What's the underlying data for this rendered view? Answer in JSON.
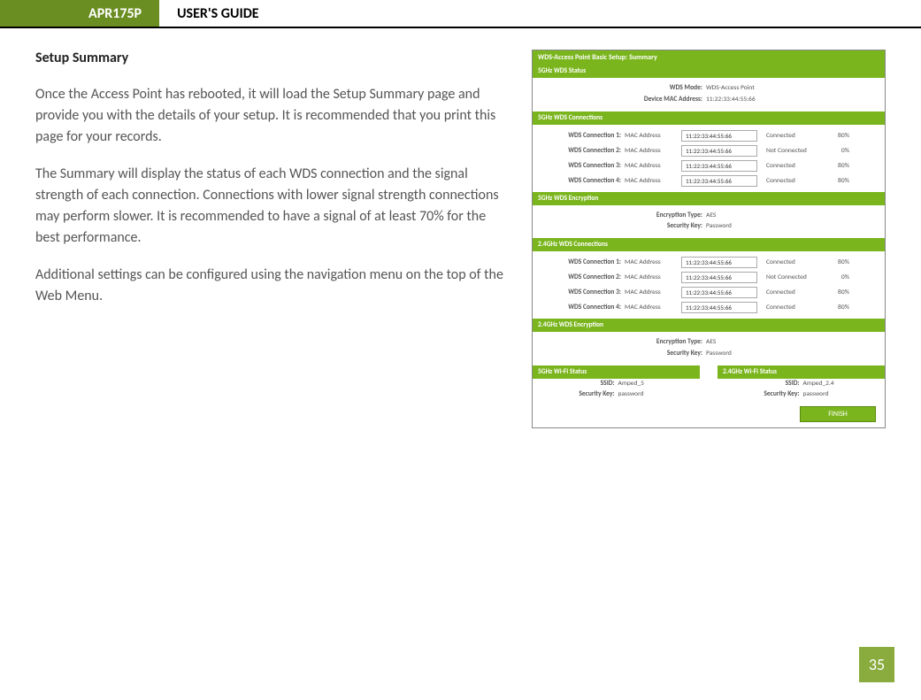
{
  "header": {
    "model": "APR175P",
    "title": "USER'S GUIDE"
  },
  "page_number": "35",
  "doc": {
    "heading": "Setup Summary",
    "p1": "Once the Access Point has rebooted, it will load the Setup Summary page and provide you with the details of your setup. It is recommended that you print this page for your records.",
    "p2": "The Summary will display the status of each WDS connection and the signal strength of each connection. Connections with lower signal strength connections may perform slower. It is recommended to have a signal of at least 70% for the best performance.",
    "p3": "Additional settings can be configured using the navigation menu on the top of the Web Menu."
  },
  "shot": {
    "title": "WDS-Access Point Basic Setup: Summary",
    "status5": {
      "bar": "5GHz WDS Status",
      "mode_label": "WDS Mode:",
      "mode_value": "WDS-Access Point",
      "mac_label": "Device MAC Address:",
      "mac_value": "11:22:33:44:55:66"
    },
    "conn5": {
      "bar": "5GHz WDS Connections",
      "rows": [
        {
          "lbl": "WDS Connection 1:",
          "sub": "MAC Address",
          "mac": "11:22:33:44:55:66",
          "status": "Connected",
          "pct": "80%"
        },
        {
          "lbl": "WDS Connection 2:",
          "sub": "MAC Address",
          "mac": "11:22:33:44:55:66",
          "status": "Not Connected",
          "pct": "0%"
        },
        {
          "lbl": "WDS Connection 3:",
          "sub": "MAC Address",
          "mac": "11:22:33:44:55:66",
          "status": "Connected",
          "pct": "80%"
        },
        {
          "lbl": "WDS Connection 4:",
          "sub": "MAC Address",
          "mac": "11:22:33:44:55:66",
          "status": "Connected",
          "pct": "80%"
        }
      ]
    },
    "enc5": {
      "bar": "5GHz WDS Encryption",
      "type_label": "Encryption Type:",
      "type_value": "AES",
      "key_label": "Security Key:",
      "key_value": "Password"
    },
    "conn24": {
      "bar": "2.4GHz WDS Connections",
      "rows": [
        {
          "lbl": "WDS Connection 1:",
          "sub": "MAC Address",
          "mac": "11:22:33:44:55:66",
          "status": "Connected",
          "pct": "80%"
        },
        {
          "lbl": "WDS Connection 2:",
          "sub": "MAC Address",
          "mac": "11:22:33:44:55:66",
          "status": "Not Connected",
          "pct": "0%"
        },
        {
          "lbl": "WDS Connection 3:",
          "sub": "MAC Address",
          "mac": "11:22:33:44:55:66",
          "status": "Connected",
          "pct": "80%"
        },
        {
          "lbl": "WDS Connection 4:",
          "sub": "MAC Address",
          "mac": "11:22:33:44:55:66",
          "status": "Connected",
          "pct": "80%"
        }
      ]
    },
    "enc24": {
      "bar": "2.4GHz WDS Encryption",
      "type_label": "Encryption Type:",
      "type_value": "AES",
      "key_label": "Security Key:",
      "key_value": "Password"
    },
    "wifi5": {
      "bar": "5GHz Wi-Fi Status",
      "ssid_label": "SSID:",
      "ssid_value": "Amped_5",
      "key_label": "Security Key:",
      "key_value": "password"
    },
    "wifi24": {
      "bar": "2.4GHz Wi-Fi Status",
      "ssid_label": "SSID:",
      "ssid_value": "Amped_2.4",
      "key_label": "Security Key:",
      "key_value": "password"
    },
    "finish": "FINISH"
  }
}
